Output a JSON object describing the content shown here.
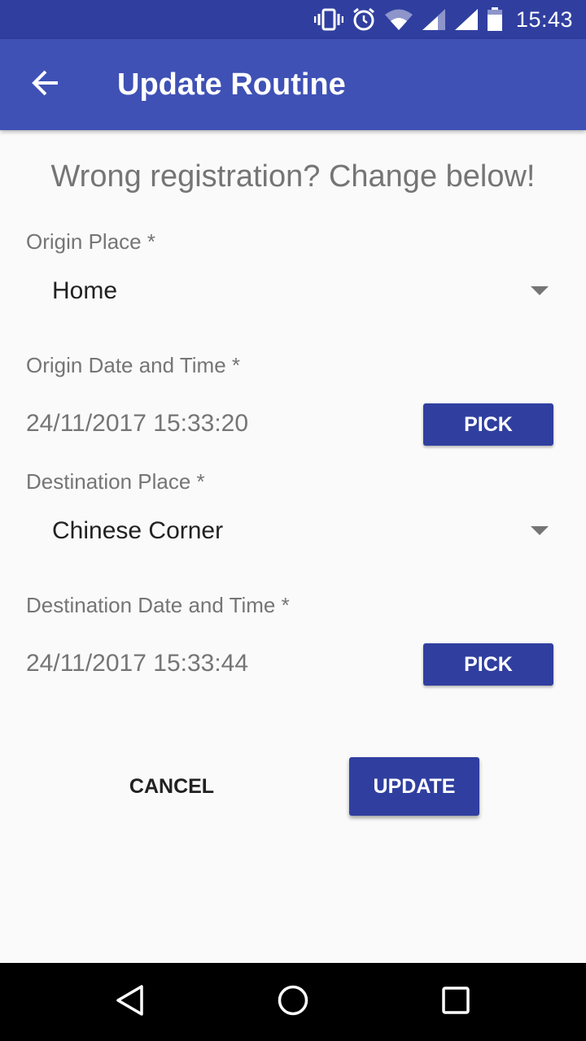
{
  "status_bar": {
    "time": "15:43",
    "icons": [
      "vibrate-icon",
      "alarm-icon",
      "wifi-icon",
      "signal-icon",
      "signal-icon",
      "battery-icon"
    ]
  },
  "app_bar": {
    "back_icon": "arrow-back-icon",
    "title": "Update Routine"
  },
  "form": {
    "headline": "Wrong registration? Change below!",
    "origin_place": {
      "label": "Origin Place *",
      "value": "Home"
    },
    "origin_datetime": {
      "label": "Origin Date and Time *",
      "value": "24/11/2017 15:33:20",
      "button": "PICK"
    },
    "destination_place": {
      "label": "Destination Place *",
      "value": "Chinese Corner"
    },
    "destination_datetime": {
      "label": "Destination Date and Time *",
      "value": "24/11/2017 15:33:44",
      "button": "PICK"
    }
  },
  "actions": {
    "cancel": "CANCEL",
    "update": "UPDATE"
  },
  "nav_bar": {
    "icons": [
      "back-triangle-icon",
      "home-circle-icon",
      "recents-square-icon"
    ]
  },
  "colors": {
    "status_bar": "#303f9f",
    "app_bar": "#3f51b5",
    "button": "#303f9f",
    "background": "#fafafa"
  }
}
